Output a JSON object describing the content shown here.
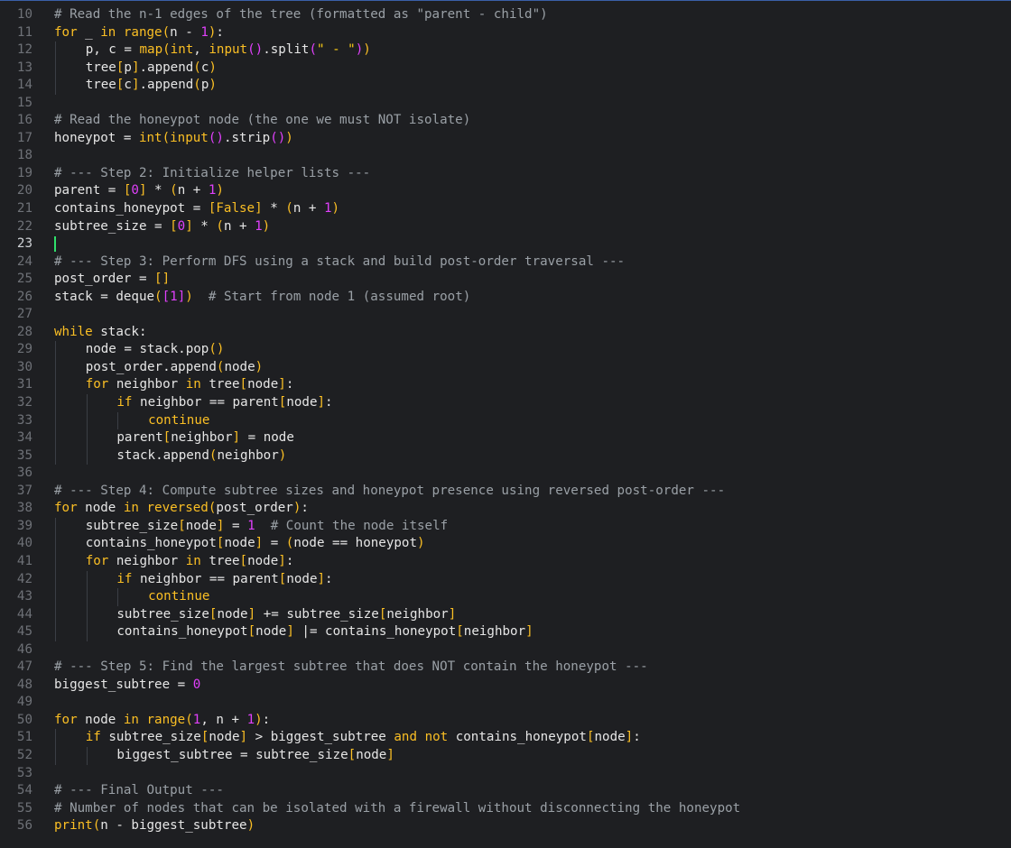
{
  "editor": {
    "language": "python",
    "current_line": "23",
    "colors": {
      "background": "#1e1f22",
      "keyword": "#fbbf24",
      "number": "#e040fb",
      "comment": "#9aa0a6",
      "text": "#e6e6e6",
      "caret": "#2fe06b"
    }
  },
  "lines": [
    {
      "num": "10",
      "indent": 0,
      "tokens": [
        [
          "com",
          "# Read the n-1 edges of the tree (formatted as \"parent - child\")"
        ]
      ]
    },
    {
      "num": "11",
      "indent": 0,
      "tokens": [
        [
          "kw",
          "for"
        ],
        [
          "id",
          " _ "
        ],
        [
          "kw",
          "in"
        ],
        [
          "id",
          " "
        ],
        [
          "bi",
          "range"
        ],
        [
          "br",
          "("
        ],
        [
          "id",
          "n - "
        ],
        [
          "num",
          "1"
        ],
        [
          "br",
          ")"
        ],
        [
          "id",
          ":"
        ]
      ]
    },
    {
      "num": "12",
      "indent": 1,
      "tokens": [
        [
          "id",
          "p, c = "
        ],
        [
          "bi",
          "map"
        ],
        [
          "br",
          "("
        ],
        [
          "bi",
          "int"
        ],
        [
          "id",
          ", "
        ],
        [
          "bi",
          "input"
        ],
        [
          "br2",
          "()"
        ],
        [
          "id",
          ".split"
        ],
        [
          "br2",
          "("
        ],
        [
          "str",
          "\" - \""
        ],
        [
          "br2",
          ")"
        ],
        [
          "br",
          ")"
        ]
      ]
    },
    {
      "num": "13",
      "indent": 1,
      "tokens": [
        [
          "id",
          "tree"
        ],
        [
          "br",
          "["
        ],
        [
          "id",
          "p"
        ],
        [
          "br",
          "]"
        ],
        [
          "id",
          ".append"
        ],
        [
          "br",
          "("
        ],
        [
          "id",
          "c"
        ],
        [
          "br",
          ")"
        ]
      ]
    },
    {
      "num": "14",
      "indent": 1,
      "tokens": [
        [
          "id",
          "tree"
        ],
        [
          "br",
          "["
        ],
        [
          "id",
          "c"
        ],
        [
          "br",
          "]"
        ],
        [
          "id",
          ".append"
        ],
        [
          "br",
          "("
        ],
        [
          "id",
          "p"
        ],
        [
          "br",
          ")"
        ]
      ]
    },
    {
      "num": "15",
      "indent": 0,
      "tokens": []
    },
    {
      "num": "16",
      "indent": 0,
      "tokens": [
        [
          "com",
          "# Read the honeypot node (the one we must NOT isolate)"
        ]
      ]
    },
    {
      "num": "17",
      "indent": 0,
      "tokens": [
        [
          "id",
          "honeypot = "
        ],
        [
          "bi",
          "int"
        ],
        [
          "br",
          "("
        ],
        [
          "bi",
          "input"
        ],
        [
          "br2",
          "()"
        ],
        [
          "id",
          ".strip"
        ],
        [
          "br2",
          "()"
        ],
        [
          "br",
          ")"
        ]
      ]
    },
    {
      "num": "18",
      "indent": 0,
      "tokens": []
    },
    {
      "num": "19",
      "indent": 0,
      "tokens": [
        [
          "com",
          "# --- Step 2: Initialize helper lists ---"
        ]
      ]
    },
    {
      "num": "20",
      "indent": 0,
      "tokens": [
        [
          "id",
          "parent = "
        ],
        [
          "br",
          "["
        ],
        [
          "num",
          "0"
        ],
        [
          "br",
          "]"
        ],
        [
          "id",
          " * "
        ],
        [
          "br",
          "("
        ],
        [
          "id",
          "n + "
        ],
        [
          "num",
          "1"
        ],
        [
          "br",
          ")"
        ]
      ]
    },
    {
      "num": "21",
      "indent": 0,
      "tokens": [
        [
          "id",
          "contains_honeypot = "
        ],
        [
          "br",
          "["
        ],
        [
          "kw",
          "False"
        ],
        [
          "br",
          "]"
        ],
        [
          "id",
          " * "
        ],
        [
          "br",
          "("
        ],
        [
          "id",
          "n + "
        ],
        [
          "num",
          "1"
        ],
        [
          "br",
          ")"
        ]
      ]
    },
    {
      "num": "22",
      "indent": 0,
      "tokens": [
        [
          "id",
          "subtree_size = "
        ],
        [
          "br",
          "["
        ],
        [
          "num",
          "0"
        ],
        [
          "br",
          "]"
        ],
        [
          "id",
          " * "
        ],
        [
          "br",
          "("
        ],
        [
          "id",
          "n + "
        ],
        [
          "num",
          "1"
        ],
        [
          "br",
          ")"
        ]
      ]
    },
    {
      "num": "23",
      "indent": 0,
      "current": true,
      "tokens": []
    },
    {
      "num": "24",
      "indent": 0,
      "tokens": [
        [
          "com",
          "# --- Step 3: Perform DFS using a stack and build post-order traversal ---"
        ]
      ]
    },
    {
      "num": "25",
      "indent": 0,
      "tokens": [
        [
          "id",
          "post_order = "
        ],
        [
          "br",
          "[]"
        ]
      ]
    },
    {
      "num": "26",
      "indent": 0,
      "tokens": [
        [
          "id",
          "stack = deque"
        ],
        [
          "br",
          "("
        ],
        [
          "br2",
          "["
        ],
        [
          "num",
          "1"
        ],
        [
          "br2",
          "]"
        ],
        [
          "br",
          ")"
        ],
        [
          "id",
          "  "
        ],
        [
          "com",
          "# Start from node 1 (assumed root)"
        ]
      ]
    },
    {
      "num": "27",
      "indent": 0,
      "tokens": []
    },
    {
      "num": "28",
      "indent": 0,
      "tokens": [
        [
          "kw",
          "while"
        ],
        [
          "id",
          " stack:"
        ]
      ]
    },
    {
      "num": "29",
      "indent": 1,
      "tokens": [
        [
          "id",
          "node = stack.pop"
        ],
        [
          "br",
          "()"
        ]
      ]
    },
    {
      "num": "30",
      "indent": 1,
      "tokens": [
        [
          "id",
          "post_order.append"
        ],
        [
          "br",
          "("
        ],
        [
          "id",
          "node"
        ],
        [
          "br",
          ")"
        ]
      ]
    },
    {
      "num": "31",
      "indent": 1,
      "tokens": [
        [
          "kw",
          "for"
        ],
        [
          "id",
          " neighbor "
        ],
        [
          "kw",
          "in"
        ],
        [
          "id",
          " tree"
        ],
        [
          "br",
          "["
        ],
        [
          "id",
          "node"
        ],
        [
          "br",
          "]"
        ],
        [
          "id",
          ":"
        ]
      ]
    },
    {
      "num": "32",
      "indent": 2,
      "tokens": [
        [
          "kw",
          "if"
        ],
        [
          "id",
          " neighbor == parent"
        ],
        [
          "br",
          "["
        ],
        [
          "id",
          "node"
        ],
        [
          "br",
          "]"
        ],
        [
          "id",
          ":"
        ]
      ]
    },
    {
      "num": "33",
      "indent": 3,
      "tokens": [
        [
          "kw",
          "continue"
        ]
      ]
    },
    {
      "num": "34",
      "indent": 2,
      "tokens": [
        [
          "id",
          "parent"
        ],
        [
          "br",
          "["
        ],
        [
          "id",
          "neighbor"
        ],
        [
          "br",
          "]"
        ],
        [
          "id",
          " = node"
        ]
      ]
    },
    {
      "num": "35",
      "indent": 2,
      "tokens": [
        [
          "id",
          "stack.append"
        ],
        [
          "br",
          "("
        ],
        [
          "id",
          "neighbor"
        ],
        [
          "br",
          ")"
        ]
      ]
    },
    {
      "num": "36",
      "indent": 0,
      "tokens": []
    },
    {
      "num": "37",
      "indent": 0,
      "tokens": [
        [
          "com",
          "# --- Step 4: Compute subtree sizes and honeypot presence using reversed post-order ---"
        ]
      ]
    },
    {
      "num": "38",
      "indent": 0,
      "tokens": [
        [
          "kw",
          "for"
        ],
        [
          "id",
          " node "
        ],
        [
          "kw",
          "in"
        ],
        [
          "id",
          " "
        ],
        [
          "bi",
          "reversed"
        ],
        [
          "br",
          "("
        ],
        [
          "id",
          "post_order"
        ],
        [
          "br",
          ")"
        ],
        [
          "id",
          ":"
        ]
      ]
    },
    {
      "num": "39",
      "indent": 1,
      "tokens": [
        [
          "id",
          "subtree_size"
        ],
        [
          "br",
          "["
        ],
        [
          "id",
          "node"
        ],
        [
          "br",
          "]"
        ],
        [
          "id",
          " = "
        ],
        [
          "num",
          "1"
        ],
        [
          "id",
          "  "
        ],
        [
          "com",
          "# Count the node itself"
        ]
      ]
    },
    {
      "num": "40",
      "indent": 1,
      "tokens": [
        [
          "id",
          "contains_honeypot"
        ],
        [
          "br",
          "["
        ],
        [
          "id",
          "node"
        ],
        [
          "br",
          "]"
        ],
        [
          "id",
          " = "
        ],
        [
          "br",
          "("
        ],
        [
          "id",
          "node == honeypot"
        ],
        [
          "br",
          ")"
        ]
      ]
    },
    {
      "num": "41",
      "indent": 1,
      "tokens": [
        [
          "kw",
          "for"
        ],
        [
          "id",
          " neighbor "
        ],
        [
          "kw",
          "in"
        ],
        [
          "id",
          " tree"
        ],
        [
          "br",
          "["
        ],
        [
          "id",
          "node"
        ],
        [
          "br",
          "]"
        ],
        [
          "id",
          ":"
        ]
      ]
    },
    {
      "num": "42",
      "indent": 2,
      "tokens": [
        [
          "kw",
          "if"
        ],
        [
          "id",
          " neighbor == parent"
        ],
        [
          "br",
          "["
        ],
        [
          "id",
          "node"
        ],
        [
          "br",
          "]"
        ],
        [
          "id",
          ":"
        ]
      ]
    },
    {
      "num": "43",
      "indent": 3,
      "tokens": [
        [
          "kw",
          "continue"
        ]
      ]
    },
    {
      "num": "44",
      "indent": 2,
      "tokens": [
        [
          "id",
          "subtree_size"
        ],
        [
          "br",
          "["
        ],
        [
          "id",
          "node"
        ],
        [
          "br",
          "]"
        ],
        [
          "id",
          " += subtree_size"
        ],
        [
          "br",
          "["
        ],
        [
          "id",
          "neighbor"
        ],
        [
          "br",
          "]"
        ]
      ]
    },
    {
      "num": "45",
      "indent": 2,
      "tokens": [
        [
          "id",
          "contains_honeypot"
        ],
        [
          "br",
          "["
        ],
        [
          "id",
          "node"
        ],
        [
          "br",
          "]"
        ],
        [
          "id",
          " |= contains_honeypot"
        ],
        [
          "br",
          "["
        ],
        [
          "id",
          "neighbor"
        ],
        [
          "br",
          "]"
        ]
      ]
    },
    {
      "num": "46",
      "indent": 0,
      "tokens": []
    },
    {
      "num": "47",
      "indent": 0,
      "tokens": [
        [
          "com",
          "# --- Step 5: Find the largest subtree that does NOT contain the honeypot ---"
        ]
      ]
    },
    {
      "num": "48",
      "indent": 0,
      "tokens": [
        [
          "id",
          "biggest_subtree = "
        ],
        [
          "num",
          "0"
        ]
      ]
    },
    {
      "num": "49",
      "indent": 0,
      "tokens": []
    },
    {
      "num": "50",
      "indent": 0,
      "tokens": [
        [
          "kw",
          "for"
        ],
        [
          "id",
          " node "
        ],
        [
          "kw",
          "in"
        ],
        [
          "id",
          " "
        ],
        [
          "bi",
          "range"
        ],
        [
          "br",
          "("
        ],
        [
          "num",
          "1"
        ],
        [
          "id",
          ", n + "
        ],
        [
          "num",
          "1"
        ],
        [
          "br",
          ")"
        ],
        [
          "id",
          ":"
        ]
      ]
    },
    {
      "num": "51",
      "indent": 1,
      "tokens": [
        [
          "kw",
          "if"
        ],
        [
          "id",
          " subtree_size"
        ],
        [
          "br",
          "["
        ],
        [
          "id",
          "node"
        ],
        [
          "br",
          "]"
        ],
        [
          "id",
          " > biggest_subtree "
        ],
        [
          "kw",
          "and"
        ],
        [
          "id",
          " "
        ],
        [
          "kw",
          "not"
        ],
        [
          "id",
          " contains_honeypot"
        ],
        [
          "br",
          "["
        ],
        [
          "id",
          "node"
        ],
        [
          "br",
          "]"
        ],
        [
          "id",
          ":"
        ]
      ]
    },
    {
      "num": "52",
      "indent": 2,
      "tokens": [
        [
          "id",
          "biggest_subtree = subtree_size"
        ],
        [
          "br",
          "["
        ],
        [
          "id",
          "node"
        ],
        [
          "br",
          "]"
        ]
      ]
    },
    {
      "num": "53",
      "indent": 0,
      "tokens": []
    },
    {
      "num": "54",
      "indent": 0,
      "tokens": [
        [
          "com",
          "# --- Final Output ---"
        ]
      ]
    },
    {
      "num": "55",
      "indent": 0,
      "tokens": [
        [
          "com",
          "# Number of nodes that can be isolated with a firewall without disconnecting the honeypot"
        ]
      ]
    },
    {
      "num": "56",
      "indent": 0,
      "tokens": [
        [
          "bi",
          "print"
        ],
        [
          "br",
          "("
        ],
        [
          "id",
          "n - biggest_subtree"
        ],
        [
          "br",
          ")"
        ]
      ]
    }
  ]
}
